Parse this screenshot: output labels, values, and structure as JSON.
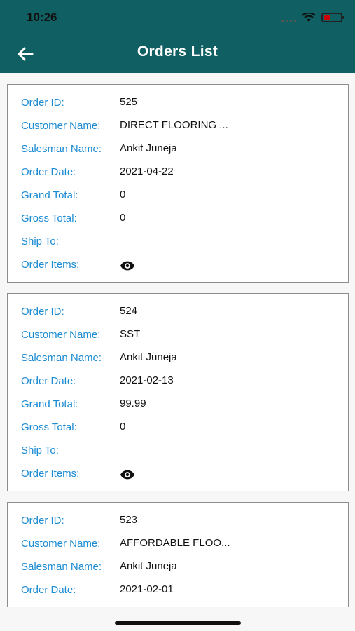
{
  "status_bar": {
    "time": "10:26"
  },
  "app_bar": {
    "title": "Orders List"
  },
  "labels": {
    "order_id": "Order ID:",
    "customer_name": "Customer Name:",
    "salesman_name": "Salesman Name:",
    "order_date": "Order Date:",
    "grand_total": "Grand Total:",
    "gross_total": "Gross Total:",
    "ship_to": "Ship To:",
    "order_items": "Order Items:"
  },
  "orders": [
    {
      "order_id": "525",
      "customer_name": "DIRECT FLOORING ...",
      "salesman_name": "Ankit Juneja",
      "order_date": "2021-04-22",
      "grand_total": "0",
      "gross_total": "0",
      "ship_to": ""
    },
    {
      "order_id": "524",
      "customer_name": "SST",
      "salesman_name": "Ankit Juneja",
      "order_date": "2021-02-13",
      "grand_total": "99.99",
      "gross_total": "0",
      "ship_to": ""
    },
    {
      "order_id": "523",
      "customer_name": "AFFORDABLE FLOO...",
      "salesman_name": "Ankit Juneja",
      "order_date": "2021-02-01"
    }
  ],
  "colors": {
    "app_bar": "#0f5f63",
    "label": "#1b8bd3",
    "value": "#111111"
  }
}
